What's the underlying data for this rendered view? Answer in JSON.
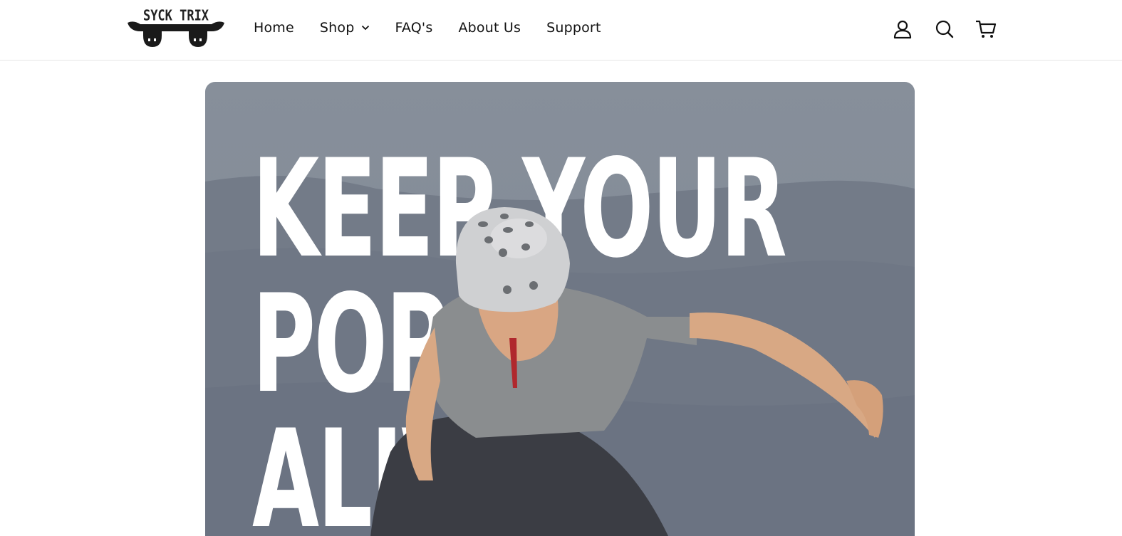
{
  "brand": {
    "name": "SYCK TRIX"
  },
  "nav": {
    "items": [
      {
        "label": "Home"
      },
      {
        "label": "Shop",
        "has_dropdown": true
      },
      {
        "label": "FAQ's"
      },
      {
        "label": "About Us"
      },
      {
        "label": "Support"
      }
    ]
  },
  "header_icons": [
    "account-icon",
    "search-icon",
    "cart-icon"
  ],
  "hero": {
    "line1": "KEEP YOUR",
    "line2": "POP",
    "line3": "ALIVE"
  },
  "colors": {
    "sky": "#868e99",
    "mountain": "#707886",
    "headline": "#ffffff",
    "text": "#111111"
  }
}
